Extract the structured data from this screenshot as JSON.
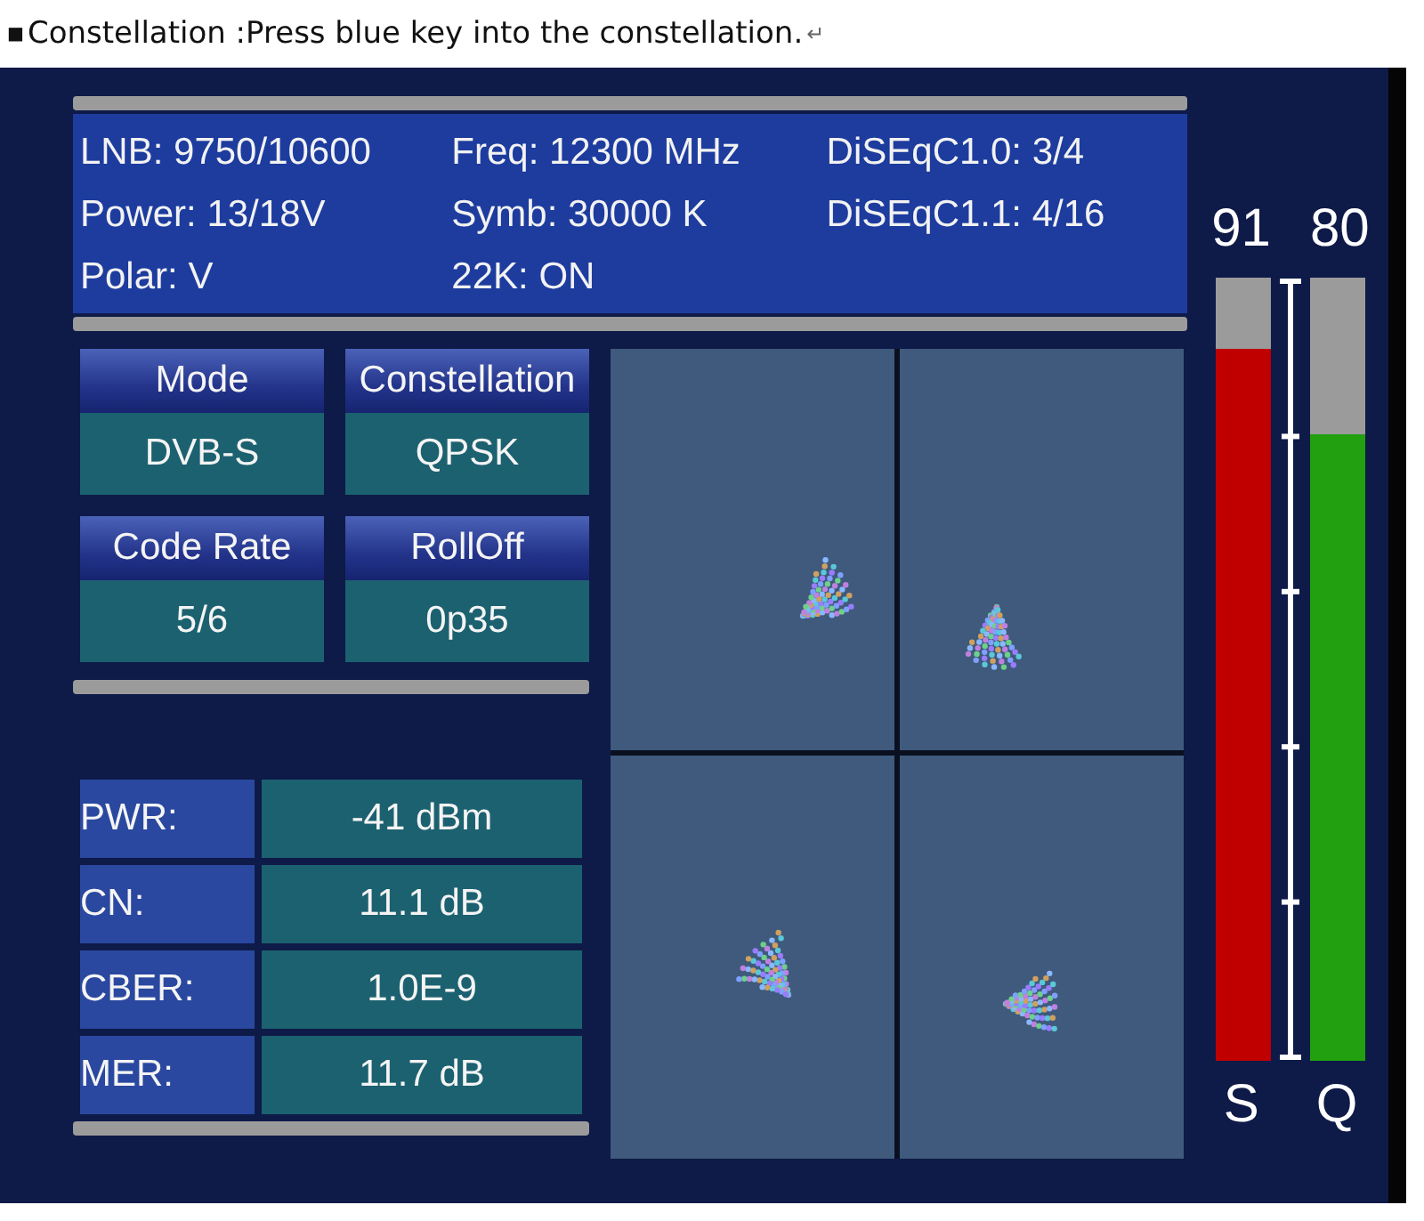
{
  "caption": {
    "bullet": "■",
    "text": "Constellation :Press blue key into the constellation.",
    "mark": "↵"
  },
  "info": [
    [
      "LNB: 9750/10600",
      "Power: 13/18V",
      "Polar: V"
    ],
    [
      "Freq: 12300 MHz",
      "Symb: 30000 K",
      "22K: ON"
    ],
    [
      "DiSEqC1.0: 3/4",
      "DiSEqC1.1: 4/16"
    ]
  ],
  "params": [
    {
      "label": "Mode",
      "value": "DVB-S"
    },
    {
      "label": "Constellation",
      "value": "QPSK"
    },
    {
      "label": "Code Rate",
      "value": "5/6"
    },
    {
      "label": "RollOff",
      "value": "0p35"
    }
  ],
  "measurements": [
    {
      "label": "PWR:",
      "value": "-41 dBm"
    },
    {
      "label": "CN:",
      "value": "11.1 dB"
    },
    {
      "label": "CBER:",
      "value": "1.0E-9"
    },
    {
      "label": "MER:",
      "value": "11.7 dB"
    }
  ],
  "meters": [
    {
      "reading": "91",
      "name": "S",
      "level": 0.91,
      "color": "#c00000"
    },
    {
      "reading": "80",
      "name": "Q",
      "level": 0.8,
      "color": "#22a010"
    }
  ]
}
